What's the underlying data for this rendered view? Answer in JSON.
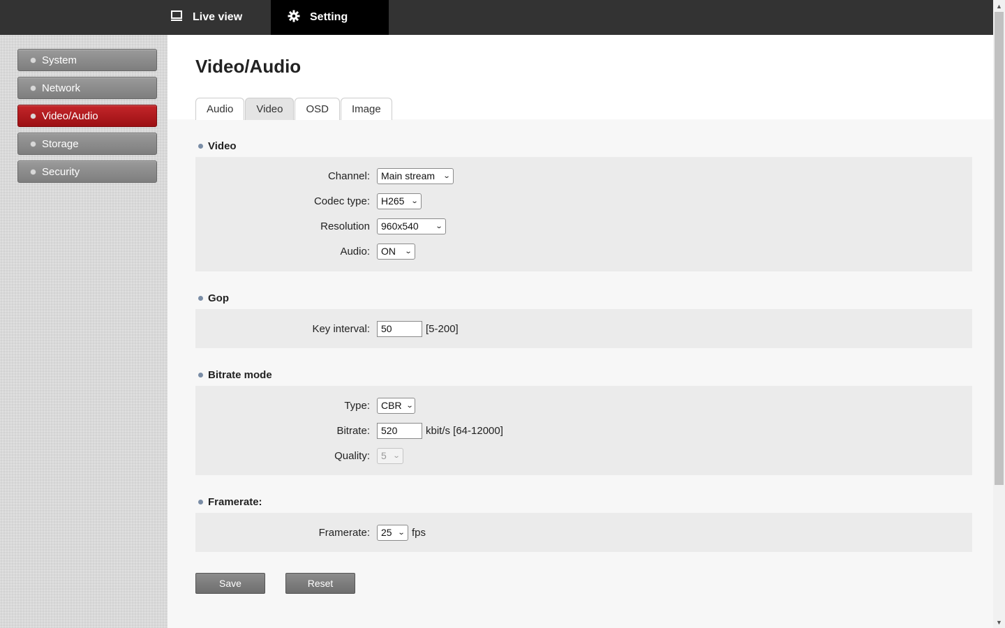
{
  "topnav": {
    "live_view": "Live view",
    "setting": "Setting"
  },
  "sidebar": {
    "items": [
      {
        "label": "System",
        "active": false
      },
      {
        "label": "Network",
        "active": false
      },
      {
        "label": "Video/Audio",
        "active": true
      },
      {
        "label": "Storage",
        "active": false
      },
      {
        "label": "Security",
        "active": false
      }
    ]
  },
  "page": {
    "title": "Video/Audio",
    "tabs": [
      {
        "label": "Audio",
        "active": false
      },
      {
        "label": "Video",
        "active": true
      },
      {
        "label": "OSD",
        "active": false
      },
      {
        "label": "Image",
        "active": false
      }
    ]
  },
  "video": {
    "title": "Video",
    "channel_label": "Channel:",
    "channel_value": "Main stream",
    "codec_label": "Codec type:",
    "codec_value": "H265",
    "resolution_label": "Resolution",
    "resolution_value": "960x540",
    "audio_label": "Audio:",
    "audio_value": "ON"
  },
  "gop": {
    "title": "Gop",
    "key_interval_label": "Key interval:",
    "key_interval_value": "50",
    "key_interval_range": "[5-200]"
  },
  "bitrate": {
    "title": "Bitrate mode",
    "type_label": "Type:",
    "type_value": "CBR",
    "bitrate_label": "Bitrate:",
    "bitrate_value": "520",
    "bitrate_unit": "kbit/s [64-12000]",
    "quality_label": "Quality:",
    "quality_value": "5"
  },
  "framerate": {
    "title": "Framerate:",
    "framerate_label": "Framerate:",
    "framerate_value": "25",
    "framerate_unit": "fps"
  },
  "actions": {
    "save": "Save",
    "reset": "Reset"
  },
  "colors": {
    "topbar": "#333333",
    "active_nav": "#000000",
    "active_side": "#b01a1e"
  }
}
